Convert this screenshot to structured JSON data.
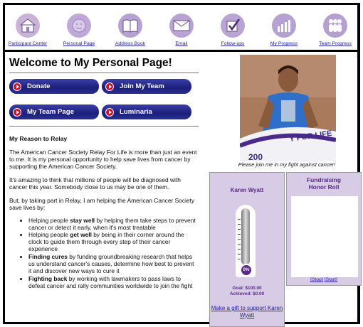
{
  "nav": [
    {
      "id": "participant-center",
      "label": "Participant Center",
      "icon": "house-icon",
      "color": "#c9b4d8"
    },
    {
      "id": "personal-page",
      "label": "Personal Page",
      "icon": "face-icon",
      "color": "#bfa9d7"
    },
    {
      "id": "address-book",
      "label": "Address Book",
      "icon": "book-icon",
      "color": "#b7a2d2"
    },
    {
      "id": "email",
      "label": "Email",
      "icon": "envelope-icon",
      "color": "#b8a4d3"
    },
    {
      "id": "follow-ups",
      "label": "Follow-ups",
      "icon": "checkbox-icon",
      "color": "#b9a5d3"
    },
    {
      "id": "my-progress",
      "label": "My Progress",
      "icon": "bar-chart-icon",
      "color": "#b6a2d1"
    },
    {
      "id": "team-progress",
      "label": "Team Progress",
      "icon": "people-icon",
      "color": "#b5a1d0"
    }
  ],
  "page": {
    "title": "Welcome to My Personal Page!",
    "buttons": [
      "Donate",
      "Join My Team",
      "My Team Page",
      "Luminaria"
    ],
    "reason_title": "My Reason to Relay",
    "para1": "The American Cancer Society Relay For Life is more than just an event to me. It is my personal opportunity to help save lives from cancer by supporting the American Cancer Society.",
    "para2": "It's amazing to think that millions of people will be diagnosed with cancer this year. Somebody close to us may be one of them.",
    "para3": "But, by taking part in Relay, I am helping the American Cancer Society save lives by:",
    "bullets": [
      {
        "pre": "Helping people ",
        "bold": "stay well",
        "post": " by helping them take steps to prevent cancer or detect it early, when it's most treatable"
      },
      {
        "pre": "Helping people ",
        "bold": "get well",
        "post": " by being in their corner around the clock to guide them through every step of their cancer experience"
      },
      {
        "pre": "",
        "bold": "Finding cures",
        "post": " by funding groundbreaking research that helps us understand cancer's causes, determine how best to prevent it and discover new ways to cure it"
      },
      {
        "pre": "",
        "bold": "Fighting back",
        "post": " by working with lawmakers to pass laws to defeat cancer and rally communities worldwide to join the fight"
      }
    ]
  },
  "photo": {
    "caption": "Please join me in my fight against cancer!",
    "banner_text": "Y FOR LIFE",
    "banner_text2": "200"
  },
  "thermometer": {
    "name": "Karen Wyatt",
    "percent_label": "0%",
    "percent": 0,
    "goal": "Goal: $100.00",
    "achieved": "Achieved: $0.00",
    "gift_link": "Make a gift to support Karen Wyatt"
  },
  "honor_roll": {
    "title": "Fundraising Honor Roll",
    "stop": "[Stop]",
    "start": "[Start]"
  }
}
